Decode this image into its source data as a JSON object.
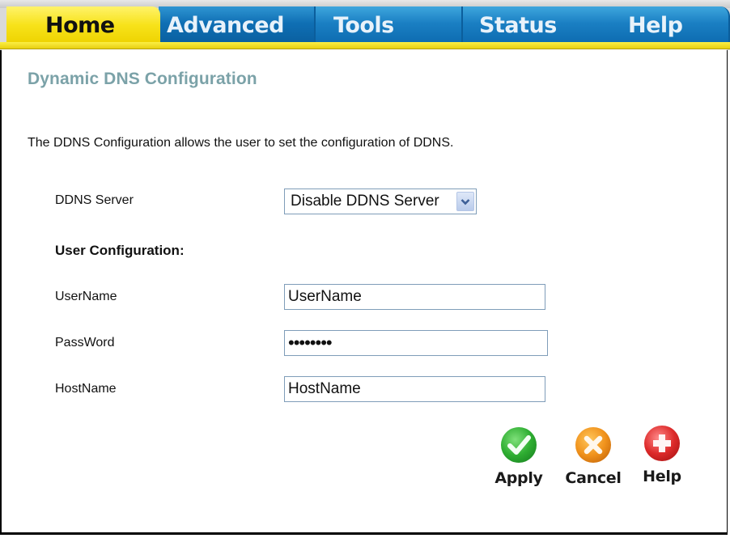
{
  "tabs": [
    {
      "label": "Home",
      "active": true
    },
    {
      "label": "Advanced",
      "active": false
    },
    {
      "label": "Tools",
      "active": false
    },
    {
      "label": "Status",
      "active": false
    },
    {
      "label": "Help",
      "active": false
    }
  ],
  "page": {
    "title": "Dynamic DNS Configuration",
    "description": "The DDNS Configuration allows the user to set the configuration of DDNS."
  },
  "form": {
    "ddns_server_label": "DDNS Server",
    "ddns_server_value": "Disable DDNS Server",
    "user_config_heading": "User Configuration:",
    "username_label": "UserName",
    "username_value": "UserName",
    "password_label": "PassWord",
    "password_value": "••••••••",
    "hostname_label": "HostName",
    "hostname_value": "HostName"
  },
  "actions": {
    "apply": "Apply",
    "cancel": "Cancel",
    "help": "Help"
  },
  "colors": {
    "tab_active": "#f7e21a",
    "tab_inactive": "#1a7fc3",
    "title": "#7ba2a8"
  }
}
